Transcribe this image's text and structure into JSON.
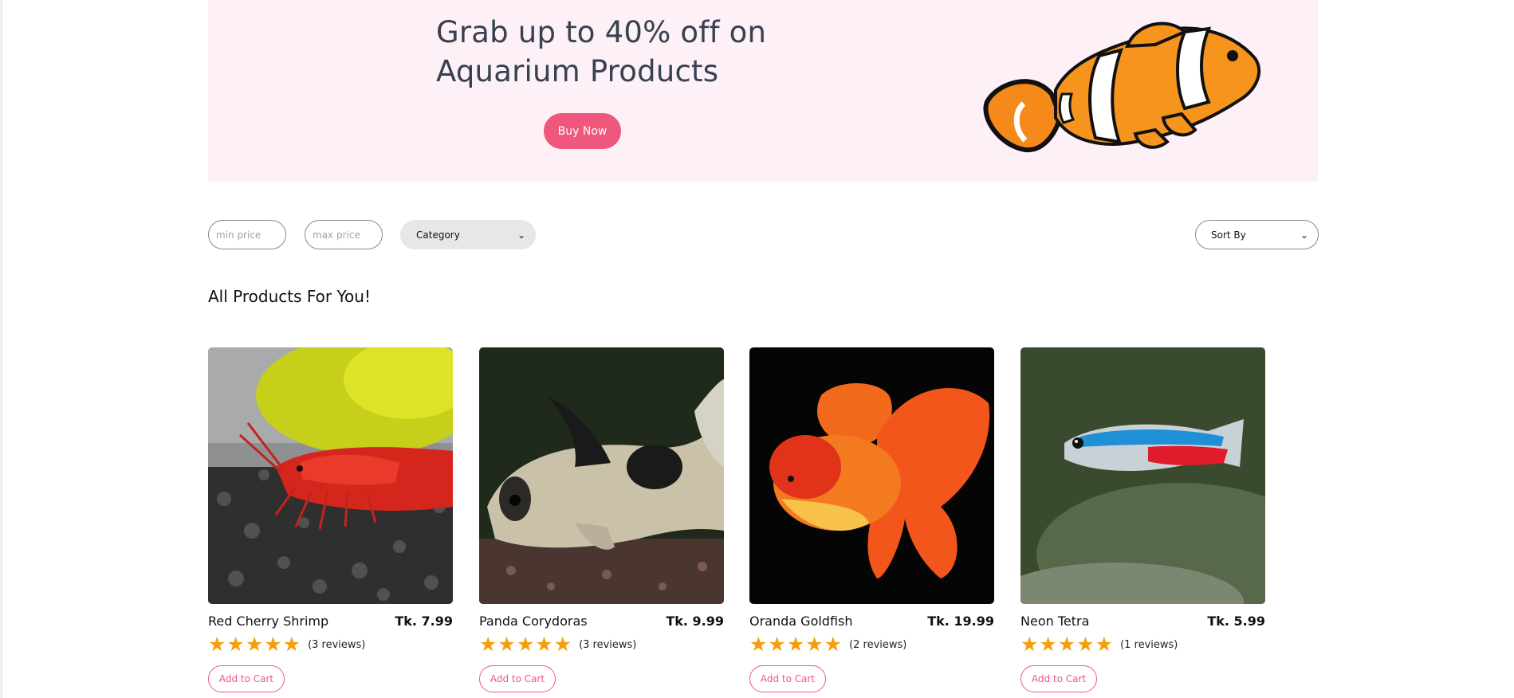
{
  "hero": {
    "title_line1": "Grab up to 40% off on",
    "title_line2": "Aquarium Products",
    "button_label": "Buy Now"
  },
  "filters": {
    "min_price_placeholder": "min price",
    "max_price_placeholder": "max price",
    "category_label": "Category",
    "sort_label": "Sort By"
  },
  "section_title": "All Products For You!",
  "products": [
    {
      "name": "Red Cherry Shrimp",
      "price": "Tk. 7.99",
      "stars": "★★★★★",
      "reviews": "(3 reviews)",
      "cart_label": "Add to Cart"
    },
    {
      "name": "Panda Corydoras",
      "price": "Tk. 9.99",
      "stars": "★★★★★",
      "reviews": "(3 reviews)",
      "cart_label": "Add to Cart"
    },
    {
      "name": "Oranda Goldfish",
      "price": "Tk. 19.99",
      "stars": "★★★★★",
      "reviews": "(2 reviews)",
      "cart_label": "Add to Cart"
    },
    {
      "name": "Neon Tetra",
      "price": "Tk. 5.99",
      "stars": "★★★★★",
      "reviews": "(1 reviews)",
      "cart_label": "Add to Cart"
    }
  ],
  "colors": {
    "accent": "#f0577d",
    "hero_bg": "#fdf0f6",
    "star": "#f59e0b"
  },
  "icons": {
    "select_chevron": "chevron-down-icon",
    "rating_star": "star-icon"
  }
}
